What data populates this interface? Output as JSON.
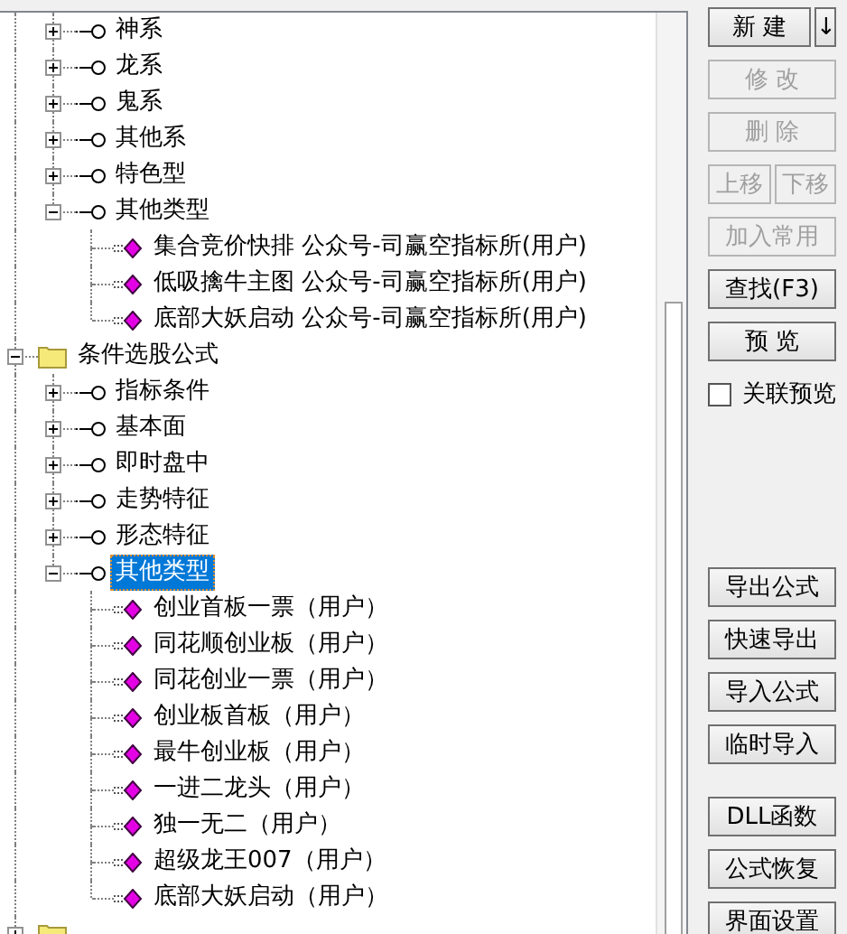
{
  "tree": {
    "nodes": [
      {
        "children": [
          {
            "kind": "category",
            "label": "神系",
            "expanded": false,
            "selected": false
          },
          {
            "kind": "category",
            "label": "龙系",
            "expanded": false,
            "selected": false
          },
          {
            "kind": "category",
            "label": "鬼系",
            "expanded": false,
            "selected": false
          },
          {
            "kind": "category",
            "label": "其他系",
            "expanded": false,
            "selected": false
          },
          {
            "kind": "category",
            "label": "特色型",
            "expanded": false,
            "selected": false
          },
          {
            "kind": "category",
            "label": "其他类型",
            "expanded": true,
            "selected": false,
            "children": [
              {
                "kind": "formula",
                "label": "集合竞价快排  公众号-司赢空指标所(用户)",
                "selected": false
              },
              {
                "kind": "formula",
                "label": "低吸擒牛主图  公众号-司赢空指标所(用户)",
                "selected": false
              },
              {
                "kind": "formula",
                "label": "底部大妖启动  公众号-司赢空指标所(用户)",
                "selected": false
              }
            ]
          }
        ]
      },
      {
        "kind": "folder",
        "label": "条件选股公式",
        "expanded": true,
        "selected": false,
        "children": [
          {
            "kind": "category",
            "label": "指标条件",
            "expanded": false,
            "selected": false
          },
          {
            "kind": "category",
            "label": "基本面",
            "expanded": false,
            "selected": false
          },
          {
            "kind": "category",
            "label": "即时盘中",
            "expanded": false,
            "selected": false
          },
          {
            "kind": "category",
            "label": "走势特征",
            "expanded": false,
            "selected": false
          },
          {
            "kind": "category",
            "label": "形态特征",
            "expanded": false,
            "selected": false
          },
          {
            "kind": "category",
            "label": "其他类型",
            "expanded": true,
            "selected": true,
            "children": [
              {
                "kind": "formula",
                "label": "创业首板一票（用户）",
                "selected": false
              },
              {
                "kind": "formula",
                "label": "同花顺创业板（用户）",
                "selected": false
              },
              {
                "kind": "formula",
                "label": "同花创业一票（用户）",
                "selected": false
              },
              {
                "kind": "formula",
                "label": "创业板首板（用户）",
                "selected": false
              },
              {
                "kind": "formula",
                "label": "最牛创业板（用户）",
                "selected": false
              },
              {
                "kind": "formula",
                "label": "一进二龙头（用户）",
                "selected": false
              },
              {
                "kind": "formula",
                "label": "独一无二（用户）",
                "selected": false
              },
              {
                "kind": "formula",
                "label": "超级龙王007（用户）",
                "selected": false
              },
              {
                "kind": "formula",
                "label": "底部大妖启动（用户）",
                "selected": false
              }
            ]
          }
        ]
      },
      {
        "kind": "folder",
        "expanded": false
      }
    ]
  },
  "side_panel": {
    "groups": [
      [
        {
          "kind": "split_button",
          "label": "新 建",
          "arrow": "↓",
          "disabled": false
        },
        {
          "kind": "button",
          "label": "修 改",
          "disabled": true
        },
        {
          "kind": "button",
          "label": "删 除",
          "disabled": true
        },
        {
          "kind": "button_pair",
          "labels": [
            "上移",
            "下移"
          ],
          "disabled": true
        },
        {
          "kind": "button",
          "label": "加入常用",
          "disabled": true
        },
        {
          "kind": "button",
          "label": "查找(F3)",
          "disabled": false
        },
        {
          "kind": "button",
          "label": "预 览",
          "disabled": false
        },
        {
          "kind": "checkbox",
          "label": "关联预览",
          "checked": false
        }
      ],
      [
        {
          "kind": "button",
          "label": "导出公式",
          "disabled": false
        },
        {
          "kind": "button",
          "label": "快速导出",
          "disabled": false
        },
        {
          "kind": "button",
          "label": "导入公式",
          "disabled": false
        },
        {
          "kind": "button",
          "label": "临时导入",
          "disabled": false
        }
      ],
      [
        {
          "kind": "button",
          "label": "DLL函数",
          "disabled": false
        },
        {
          "kind": "button",
          "label": "公式恢复",
          "disabled": false
        },
        {
          "kind": "button",
          "label": "界面设置",
          "disabled": false
        }
      ]
    ]
  }
}
